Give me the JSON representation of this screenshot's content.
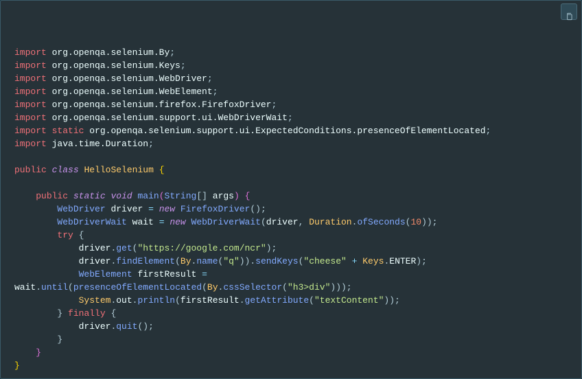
{
  "code": {
    "imports": [
      "org.openqa.selenium.By",
      "org.openqa.selenium.Keys",
      "org.openqa.selenium.WebDriver",
      "org.openqa.selenium.WebElement",
      "org.openqa.selenium.firefox.FirefoxDriver",
      "org.openqa.selenium.support.ui.WebDriverWait"
    ],
    "static_import": "org.openqa.selenium.support.ui.ExpectedConditions.presenceOfElementLocated",
    "last_import": "java.time.Duration",
    "class_decl": {
      "public": "public",
      "class": "class",
      "name": "HelloSelenium"
    },
    "main": {
      "public": "public",
      "static": "static",
      "void": "void",
      "name": "main",
      "arg_type": "String",
      "arg_name": "args"
    },
    "line1": {
      "type": "WebDriver",
      "var": "driver",
      "new": "new",
      "ctor": "FirefoxDriver"
    },
    "line2": {
      "type": "WebDriverWait",
      "var": "wait",
      "new": "new",
      "ctor": "WebDriverWait",
      "arg1": "driver",
      "dur_class": "Duration",
      "dur_method": "ofSeconds",
      "dur_val": "10"
    },
    "try": "try",
    "get": {
      "obj": "driver",
      "method": "get",
      "url": "\"https://google.com/ncr\""
    },
    "find": {
      "obj": "driver",
      "find": "findElement",
      "by": "By",
      "byMethod": "name",
      "byArg": "\"q\"",
      "send": "sendKeys",
      "sendArg1": "\"cheese\"",
      "keys": "Keys",
      "enter": "ENTER"
    },
    "decl3": {
      "type": "WebElement",
      "var": "firstResult"
    },
    "wait_line": {
      "wait": "wait",
      "until": "until",
      "presence": "presenceOfElementLocated",
      "by": "By",
      "css": "cssSelector",
      "cssArg": "\"h3>div\""
    },
    "println": {
      "sys": "System",
      "out": "out",
      "println": "println",
      "fr": "firstResult",
      "getAttr": "getAttribute",
      "attrArg": "\"textContent\""
    },
    "finally": "finally",
    "quit": {
      "obj": "driver",
      "method": "quit"
    },
    "kw_import": "import",
    "kw_static": "static"
  }
}
